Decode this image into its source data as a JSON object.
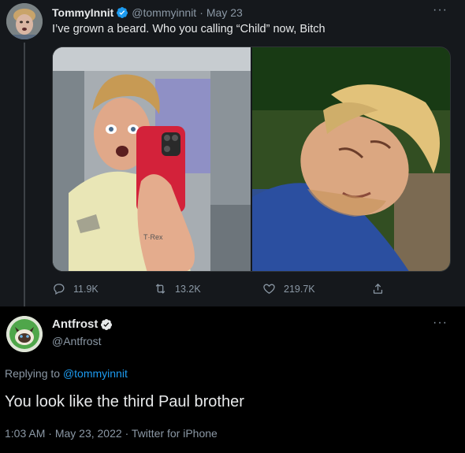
{
  "tweet": {
    "author_name": "TommyInnit",
    "handle": "@tommyinnit",
    "separator": "·",
    "date": "May 23",
    "text": "I’ve grown a beard. Who you calling “Child” now, Bitch",
    "more_icon": "more-dots-icon",
    "media": {
      "photo1_shirt_text": "T·Rex",
      "photo_count": 2
    },
    "stats": {
      "replies": "11.9K",
      "retweets": "13.2K",
      "likes": "219.7K"
    }
  },
  "reply": {
    "author_name": "Antfrost",
    "handle": "@Antfrost",
    "replying_prefix": "Replying to",
    "replying_to": "@tommyinnit",
    "text": "You look like the third Paul brother",
    "time": "1:03 AM",
    "date": "May 23, 2022",
    "separator": "·",
    "source": "Twitter for iPhone"
  },
  "colors": {
    "verified": "#1d9bf0",
    "link": "#1d9bf0",
    "muted": "#8b98a5",
    "text": "#e7e9ea",
    "top_bg": "#15181c",
    "bottom_bg": "#000000"
  }
}
